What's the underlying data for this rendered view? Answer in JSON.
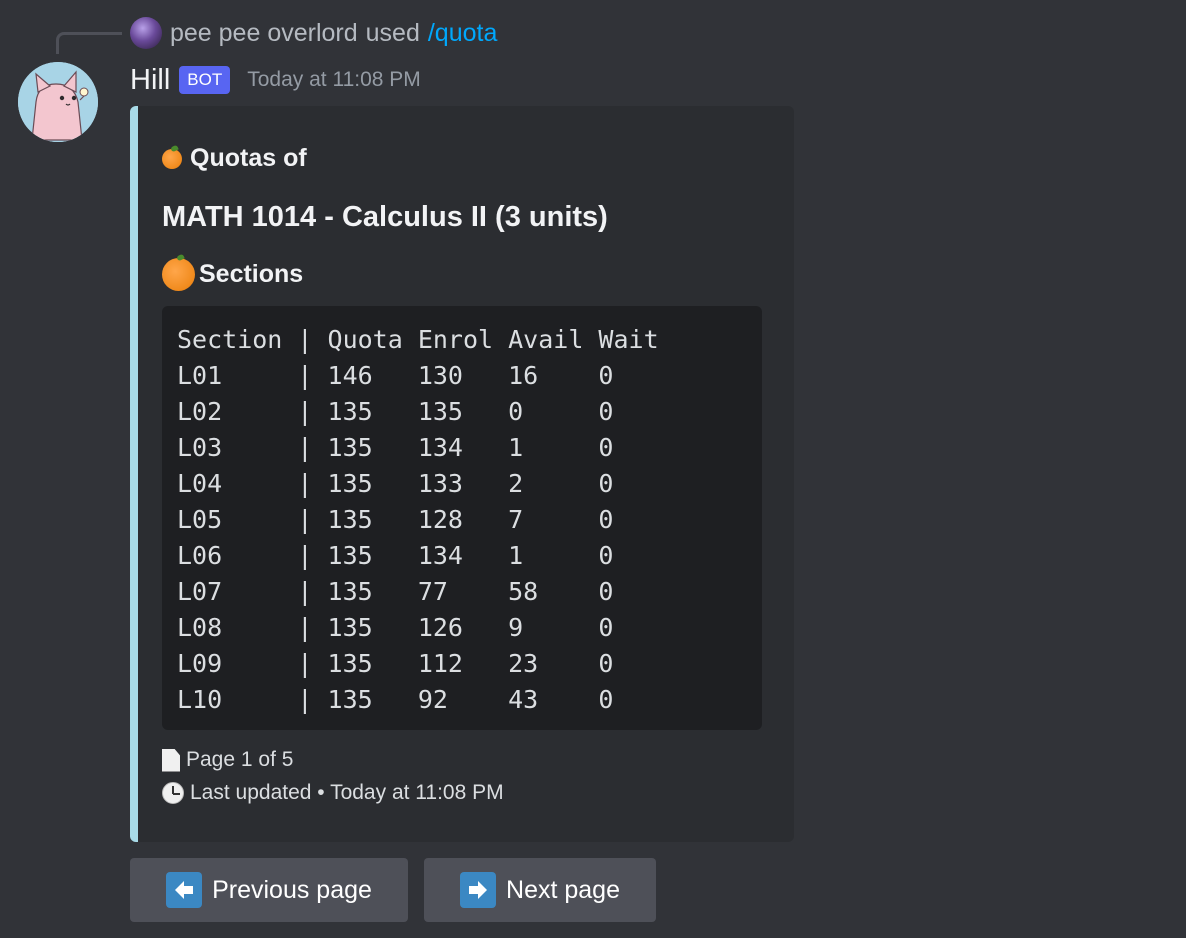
{
  "reply": {
    "user": "pee pee overlord",
    "used": "used",
    "command": "/quota"
  },
  "message": {
    "username": "Hill",
    "bot_tag": "BOT",
    "timestamp": "Today at 11:08 PM"
  },
  "embed": {
    "author": "Quotas of",
    "title": "MATH 1014 - Calculus II (3 units)",
    "field_name": "Sections",
    "code_lines": [
      "Section | Quota Enrol Avail Wait",
      "L01     | 146   130   16    0",
      "L02     | 135   135   0     0",
      "L03     | 135   134   1     0",
      "L04     | 135   133   2     0",
      "L05     | 135   128   7     0",
      "L06     | 135   134   1     0",
      "L07     | 135   77    58    0",
      "L08     | 135   126   9     0",
      "L09     | 135   112   23    0",
      "L10     | 135   92    43    0"
    ],
    "page_text": "Page 1 of 5",
    "footer": "Last updated • Today at 11:08 PM",
    "accent_color": "#a8dbe8"
  },
  "buttons": {
    "prev_label": "Previous page",
    "next_label": "Next page"
  },
  "icons": {
    "author": "tangerine-icon",
    "field": "orange-icon",
    "page": "page-icon",
    "clock": "clock-icon",
    "prev": "left-arrow-icon",
    "next": "right-arrow-icon"
  }
}
